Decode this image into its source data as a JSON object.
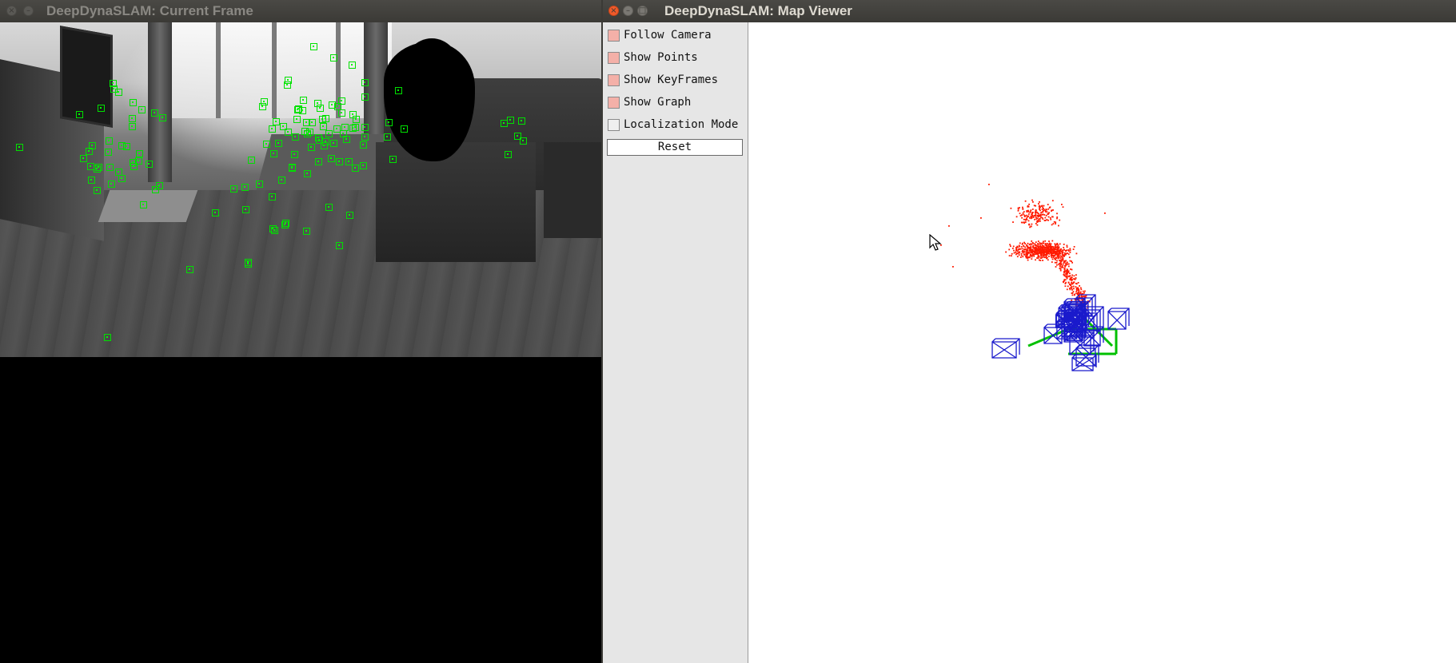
{
  "left_window": {
    "title": "DeepDynaSLAM: Current Frame",
    "frame_description_icon": "camera-frame"
  },
  "right_window": {
    "title": "DeepDynaSLAM: Map Viewer",
    "controls": [
      {
        "label": "Follow Camera",
        "checked": true
      },
      {
        "label": "Show Points",
        "checked": true
      },
      {
        "label": "Show KeyFrames",
        "checked": true
      },
      {
        "label": "Show Graph",
        "checked": true
      },
      {
        "label": "Localization Mode",
        "checked": false
      }
    ],
    "reset_label": "Reset"
  },
  "colors": {
    "titlebar": "#3b3a36",
    "close_button": "#f05a2a",
    "checkbox_on": "#f4b0a8",
    "map_points": "#ff1a00",
    "keyframes": "#1a1acc",
    "graph": "#00c000",
    "features": "#00e000"
  },
  "icons": [
    "close-icon",
    "minimize-icon",
    "maximize-icon",
    "mouse-pointer-icon"
  ]
}
